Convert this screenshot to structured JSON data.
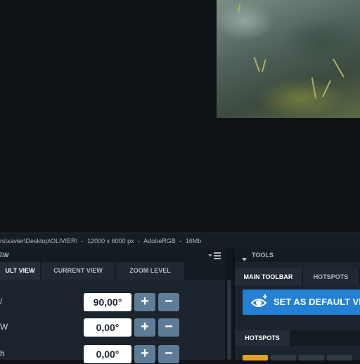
{
  "statusbar": {
    "path": "rs\\xavier\\Desktop\\OLIVIER\\",
    "sep1": "-",
    "dimensions": "12000 x 6000 px",
    "sep2": "-",
    "colorspace": "AdobeRGB",
    "sep3": "-",
    "filesize": "16Mb"
  },
  "view_panel": {
    "title": "EW",
    "menu_icon": "dropdown-menu-icon",
    "tabs": [
      {
        "label": "ULT VIEW",
        "active": true
      },
      {
        "label": "CURRENT VIEW",
        "active": false
      },
      {
        "label": "ZOOM LEVEL",
        "active": false
      }
    ],
    "rows": [
      {
        "label": "/",
        "value": "90,00°",
        "plus": "+",
        "minus": "−"
      },
      {
        "label": "W",
        "value": "0,00°",
        "plus": "+",
        "minus": "−"
      },
      {
        "label": "h",
        "value": "0,00°",
        "plus": "+",
        "minus": "−"
      }
    ]
  },
  "tools_panel": {
    "title": "TOOLS",
    "collapse_icon": "triangle-down-icon",
    "tabs": [
      {
        "label": "MAIN TOOLBAR",
        "active": true
      },
      {
        "label": "HOTSPOTS",
        "active": false
      }
    ],
    "default_view_button": "SET AS DEFAULT VI",
    "default_view_icon": "eye-plus-icon"
  },
  "hotspots_panel": {
    "tab": "HOTSPOTS"
  },
  "colors": {
    "accent": "#2380d2",
    "orange": "#e8a020",
    "button": "#5d7c98"
  }
}
